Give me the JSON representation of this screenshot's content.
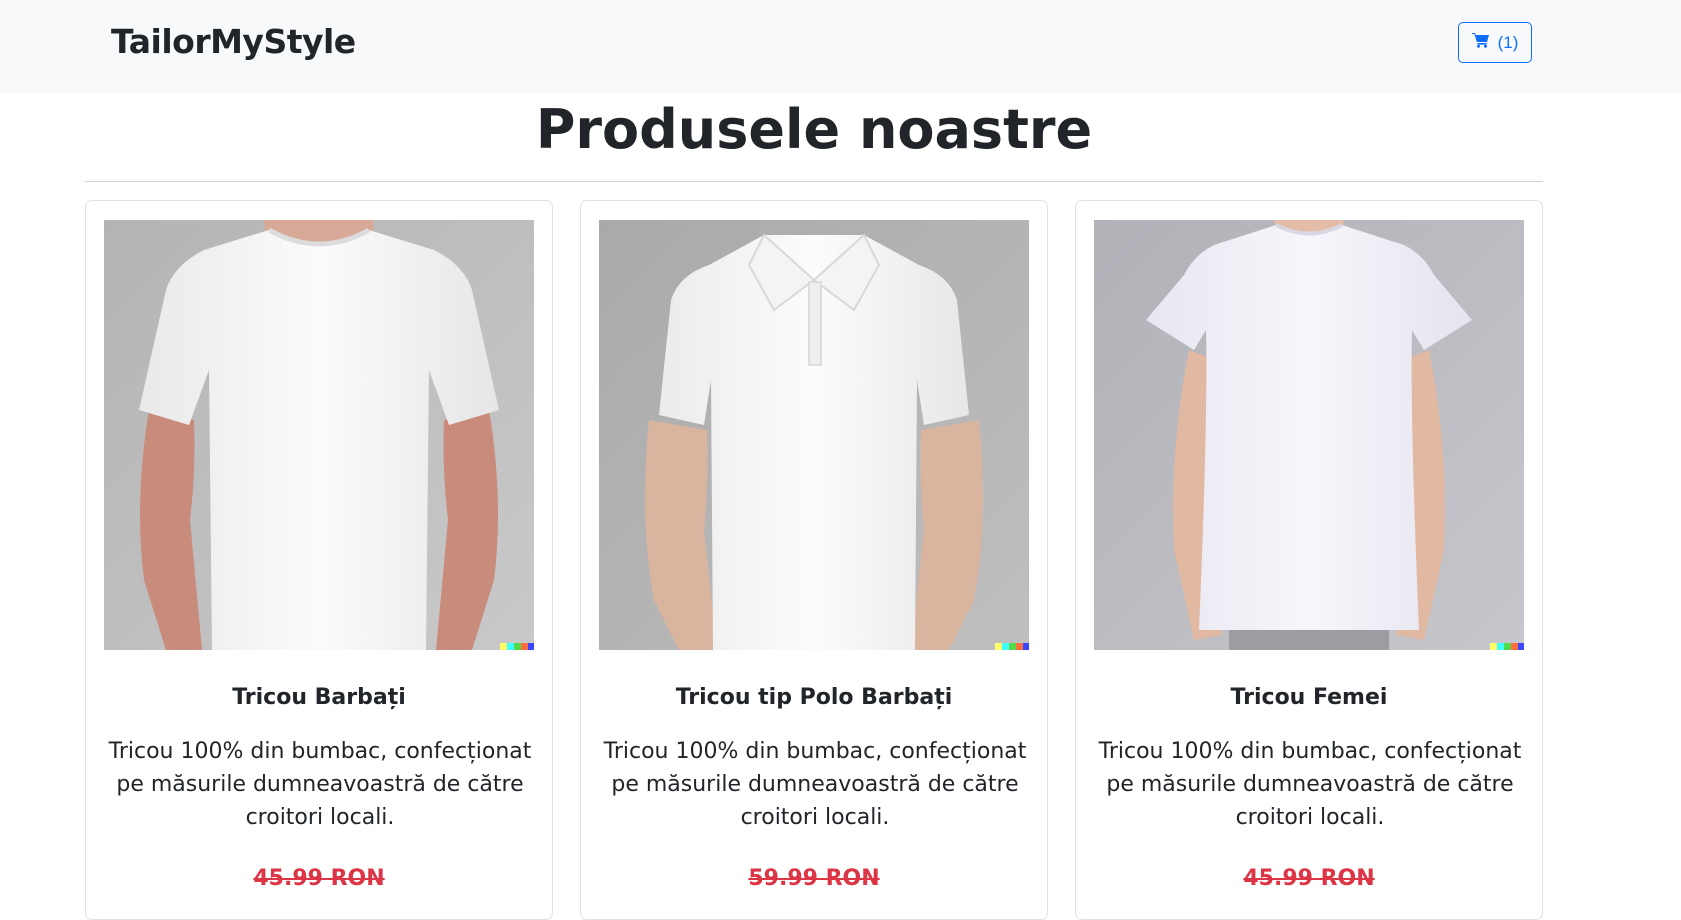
{
  "navbar": {
    "brand": "TailorMyStyle",
    "cart_label": "(1)",
    "cart_icon": "shopping-cart-icon"
  },
  "page": {
    "title": "Produsele noastre"
  },
  "products": [
    {
      "title": "Tricou Barbați",
      "description": "Tricou 100% din bumbac, confecționat pe măsurile dumneavoastră de către croitori locali.",
      "old_price": "45.99 RON",
      "image": "men-tshirt-photo"
    },
    {
      "title": "Tricou tip Polo Barbați",
      "description": "Tricou 100% din bumbac, confecționat pe măsurile dumneavoastră de către croitori locali.",
      "old_price": "59.99 RON",
      "image": "men-polo-photo"
    },
    {
      "title": "Tricou Femei",
      "description": "Tricou 100% din bumbac, confecționat pe măsurile dumneavoastră de către croitori locali.",
      "old_price": "45.99 RON",
      "image": "women-tshirt-photo"
    }
  ],
  "colors": {
    "navbar_bg": "#f8f9fa",
    "accent": "#0d6efd",
    "price_strike": "#dc3545"
  }
}
